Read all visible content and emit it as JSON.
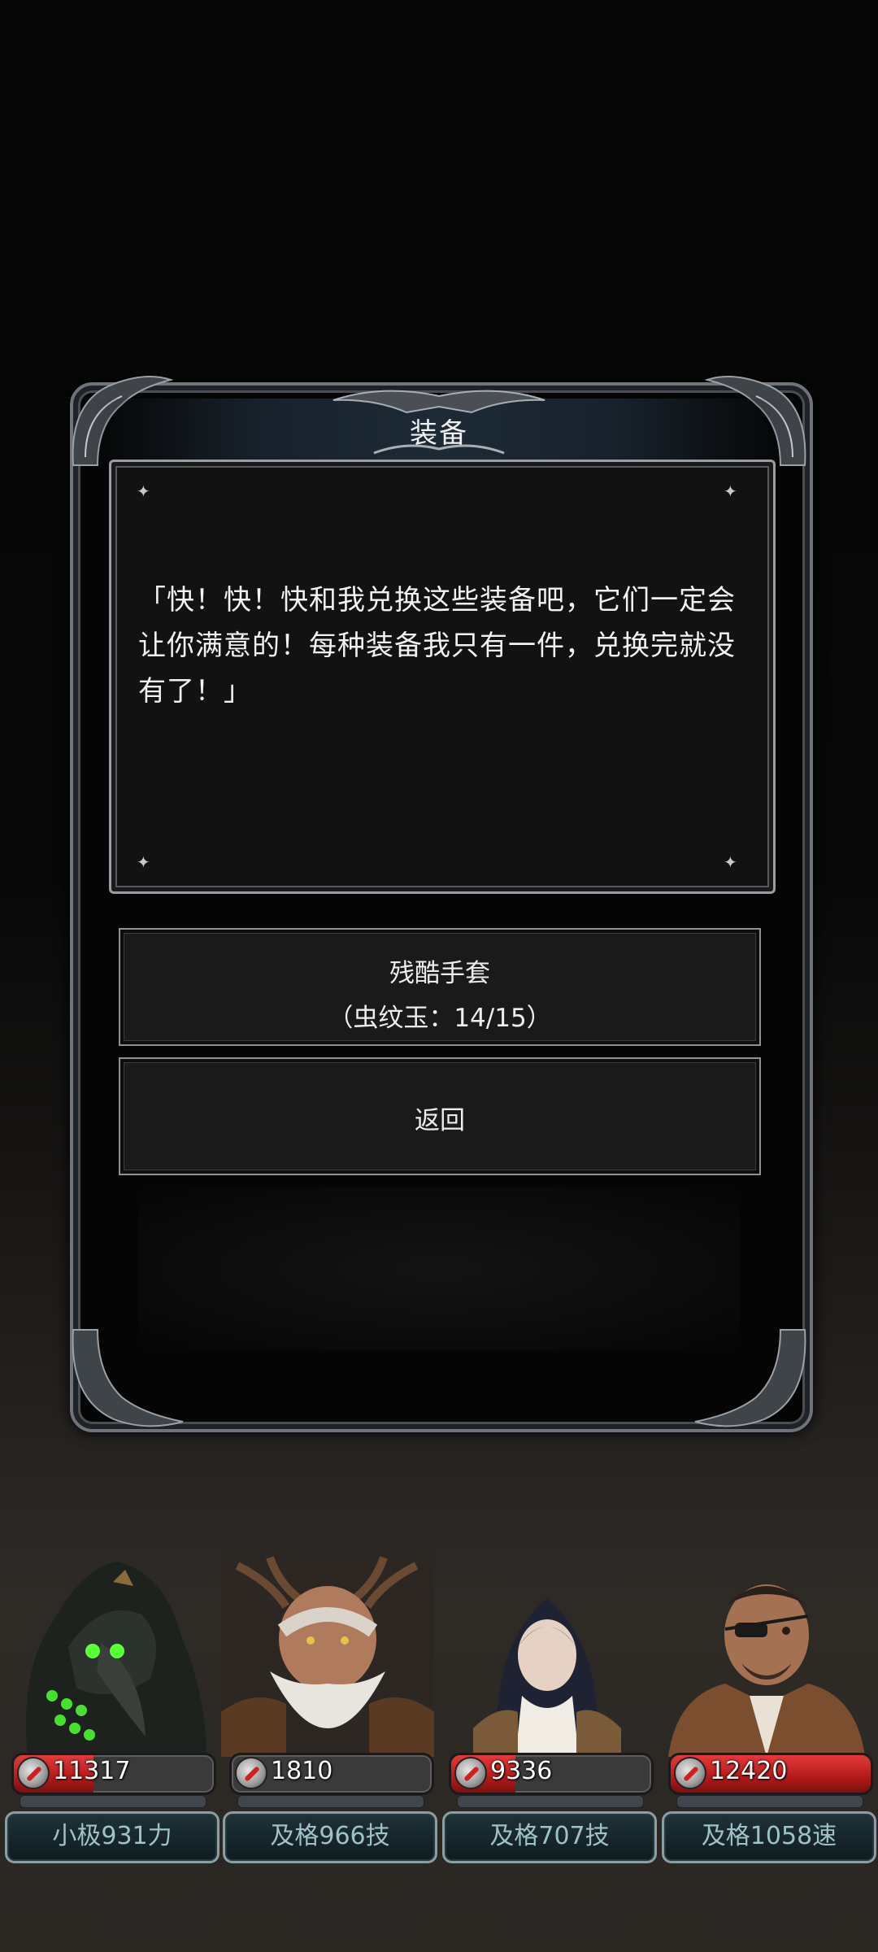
{
  "dialog": {
    "title": "装备",
    "message": "「快！快！快和我兑换这些装备吧，它们一定会让你满意的！每种装备我只有一件，兑换完就没有了！」",
    "options": [
      {
        "line1": "残酷手套",
        "line2": "（虫纹玉：14/15）"
      },
      {
        "line1": "返回"
      }
    ]
  },
  "party": [
    {
      "hp": "11317",
      "hp_fraction": 0.4,
      "stat": "小极931力",
      "portrait": "plague-doctor"
    },
    {
      "hp": "1810",
      "hp_fraction": 0.0,
      "stat": "及格966技",
      "portrait": "antlered-druid"
    },
    {
      "hp": "9336",
      "hp_fraction": 0.32,
      "stat": "及格707技",
      "portrait": "nun"
    },
    {
      "hp": "12420",
      "hp_fraction": 1.0,
      "stat": "及格1058速",
      "portrait": "eyepatch-rogue"
    }
  ],
  "colors": {
    "hp_red": "#d42424",
    "stat_text": "#9ec2c7",
    "frame": "#6f747a"
  }
}
